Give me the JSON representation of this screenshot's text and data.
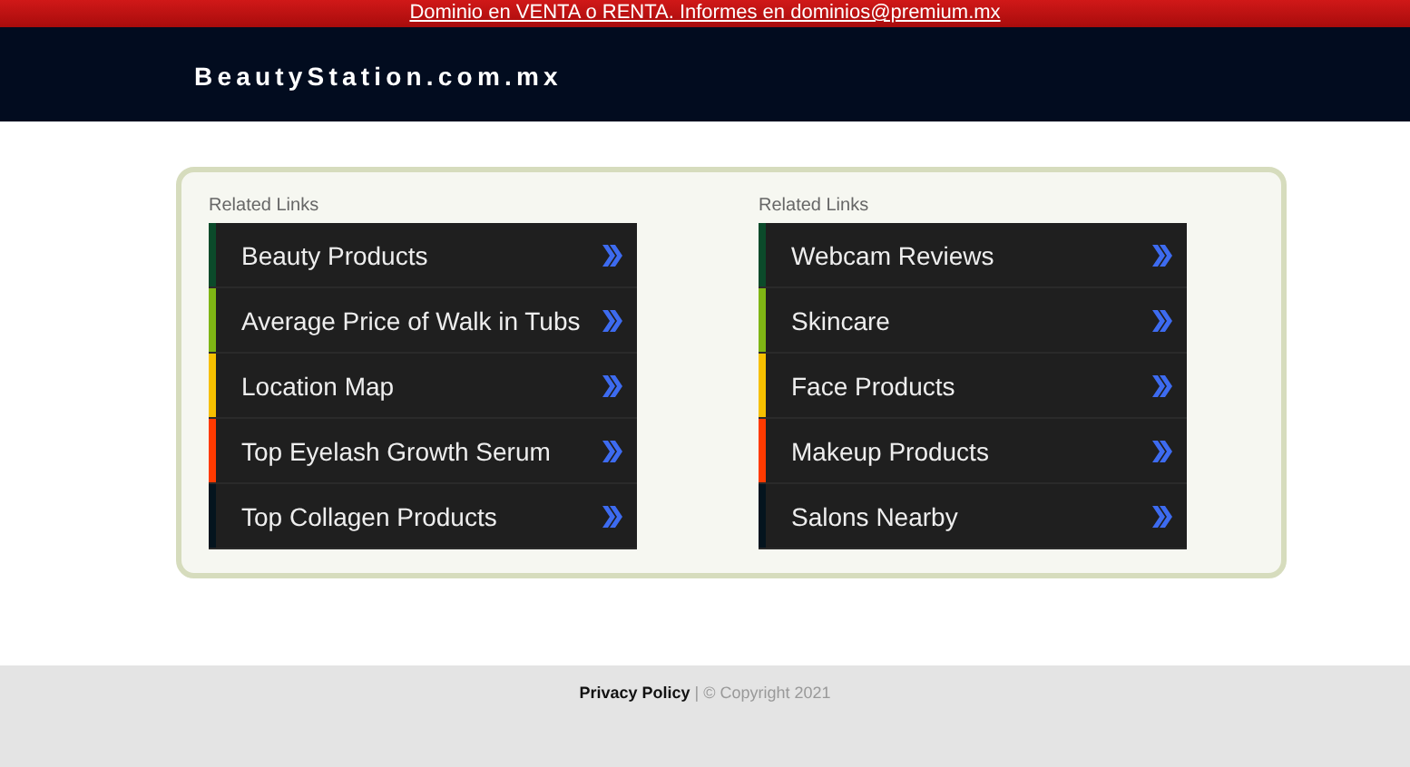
{
  "top_banner": {
    "text": "Dominio en VENTA o RENTA. Informes en dominios@premium.mx"
  },
  "header": {
    "site_title": "BeautyStation.com.mx"
  },
  "columns": [
    {
      "heading": "Related Links",
      "links": [
        {
          "label": "Beauty Products",
          "color": "#0b4a2a"
        },
        {
          "label": "Average Price of Walk in Tubs",
          "color": "#7fb514"
        },
        {
          "label": "Location Map",
          "color": "#f6c000"
        },
        {
          "label": "Top Eyelash Growth Serum",
          "color": "#ff3a00"
        },
        {
          "label": "Top Collagen Products",
          "color": "#04141e"
        }
      ]
    },
    {
      "heading": "Related Links",
      "links": [
        {
          "label": "Webcam Reviews",
          "color": "#0b4a2a"
        },
        {
          "label": "Skincare",
          "color": "#7fb514"
        },
        {
          "label": "Face Products",
          "color": "#f6c000"
        },
        {
          "label": "Makeup Products",
          "color": "#ff3a00"
        },
        {
          "label": "Salons Nearby",
          "color": "#04141e"
        }
      ]
    }
  ],
  "footer": {
    "privacy_link": "Privacy Policy",
    "copyright": "| © Copyright 2021"
  }
}
